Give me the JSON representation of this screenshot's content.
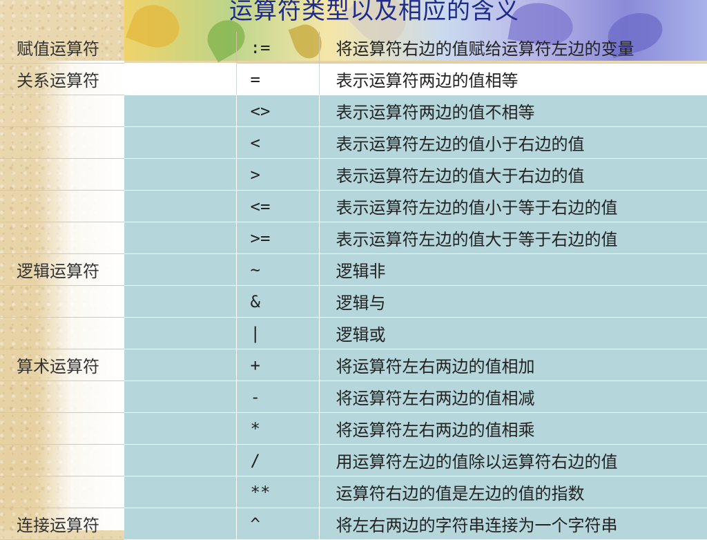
{
  "title": "运算符类型以及相应的含义",
  "rows": [
    {
      "category": "赋值运算符",
      "symbol": ":=",
      "meaning": "将运算符右边的值赋给运算符左边的变量"
    },
    {
      "category": "关系运算符",
      "symbol": "=",
      "meaning": "表示运算符两边的值相等"
    },
    {
      "category": "",
      "symbol": "<>",
      "meaning": "表示运算符两边的值不相等"
    },
    {
      "category": "",
      "symbol": "<",
      "meaning": "表示运算符左边的值小于右边的值"
    },
    {
      "category": "",
      "symbol": ">",
      "meaning": "表示运算符左边的值大于右边的值"
    },
    {
      "category": "",
      "symbol": "<=",
      "meaning": "表示运算符左边的值小于等于右边的值"
    },
    {
      "category": "",
      "symbol": ">=",
      "meaning": "表示运算符左边的值大于等于右边的值"
    },
    {
      "category": "逻辑运算符",
      "symbol": "~",
      "meaning": "逻辑非"
    },
    {
      "category": "",
      "symbol": "&",
      "meaning": "逻辑与"
    },
    {
      "category": "",
      "symbol": "|",
      "meaning": "逻辑或"
    },
    {
      "category": "算术运算符",
      "symbol": "+",
      "meaning": "将运算符左右两边的值相加"
    },
    {
      "category": "",
      "symbol": "-",
      "meaning": "将运算符左右两边的值相减"
    },
    {
      "category": "",
      "symbol": "*",
      "meaning": "将运算符左右两边的值相乘"
    },
    {
      "category": "",
      "symbol": "/",
      "meaning": "用运算符左边的值除以运算符右边的值"
    },
    {
      "category": "",
      "symbol": "**",
      "meaning": "运算符右边的值是左边的值的指数"
    },
    {
      "category": "连接运算符",
      "symbol": "^",
      "meaning": "将左右两边的字符串连接为一个字符串"
    }
  ]
}
